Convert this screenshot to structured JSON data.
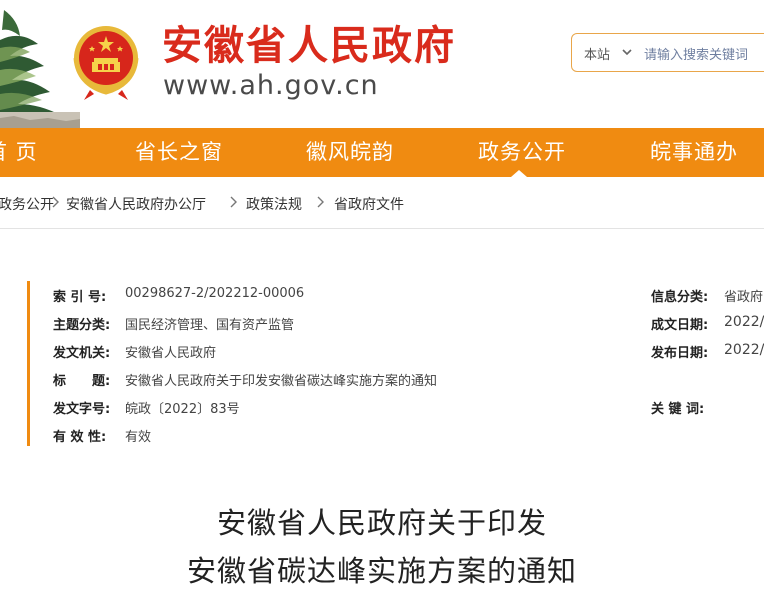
{
  "header": {
    "site_name": "安徽省人民政府",
    "site_url": "www.ah.gov.cn",
    "brand_color": "#d92b1c",
    "search": {
      "scope": "本站",
      "placeholder": "请输入搜索关键词"
    }
  },
  "nav": {
    "color": "#f08b11",
    "items": [
      {
        "label": "首 页"
      },
      {
        "label": "省长之窗"
      },
      {
        "label": "徽风皖韵"
      },
      {
        "label": "政务公开"
      },
      {
        "label": "皖事通办"
      }
    ],
    "active": "政务公开"
  },
  "breadcrumb": {
    "items": [
      "政务公开",
      "安徽省人民政府办公厅",
      "政策法规",
      "省政府文件"
    ]
  },
  "info": {
    "left": [
      {
        "label": "索 引 号:",
        "value": "00298627-2/202212-00006"
      },
      {
        "label": "主题分类:",
        "value": "国民经济管理、国有资产监管"
      },
      {
        "label": "发文机关:",
        "value": "安徽省人民政府"
      },
      {
        "label": "标　　题:",
        "value": "安徽省人民政府关于印发安徽省碳达峰实施方案的通知"
      },
      {
        "label": "发文字号:",
        "value": "皖政〔2022〕83号"
      },
      {
        "label": "有 效 性:",
        "value": "有效"
      }
    ],
    "right": [
      {
        "label": "信息分类:",
        "value": "省政府"
      },
      {
        "label": "成文日期:",
        "value": "2022/"
      },
      {
        "label": "发布日期:",
        "value": "2022/"
      },
      {
        "label": "关 键 词:",
        "value": ""
      }
    ]
  },
  "document": {
    "title_line1": "安徽省人民政府关于印发",
    "title_line2": "安徽省碳达峰实施方案的通知"
  }
}
